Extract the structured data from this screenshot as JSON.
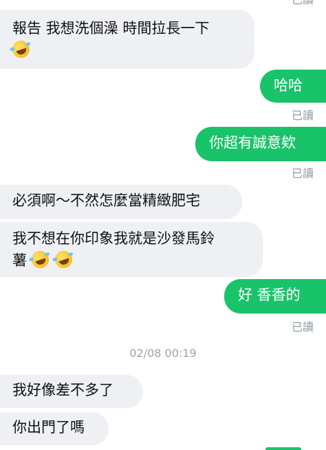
{
  "messages": [
    {
      "side": "in",
      "text": "報告 我想洗個澡 時間拉長一下",
      "emoji": 1
    },
    {
      "side": "out",
      "text": "哈哈",
      "status": "已讀"
    },
    {
      "side": "out",
      "text": "你超有誠意欸",
      "status": "已讀"
    },
    {
      "side": "in",
      "text": "必須啊～不然怎麼當精緻肥宅"
    },
    {
      "side": "in",
      "text": "我不想在你印象我就是沙發馬鈴",
      "text2": "薯",
      "emoji": 2
    },
    {
      "side": "out",
      "text": "好 香香的",
      "status": "已讀"
    },
    {
      "side": "in",
      "text": "我好像差不多了"
    },
    {
      "side": "in",
      "text": "你出門了嗎"
    }
  ],
  "top_status": "已讀",
  "timestamp": "02/08 00:19",
  "icons": {
    "laugh": "rolling-on-floor-laughing-icon"
  },
  "colors": {
    "sent": "#19c36a",
    "received": "#eef0f3",
    "meta": "#8e9aa6"
  }
}
